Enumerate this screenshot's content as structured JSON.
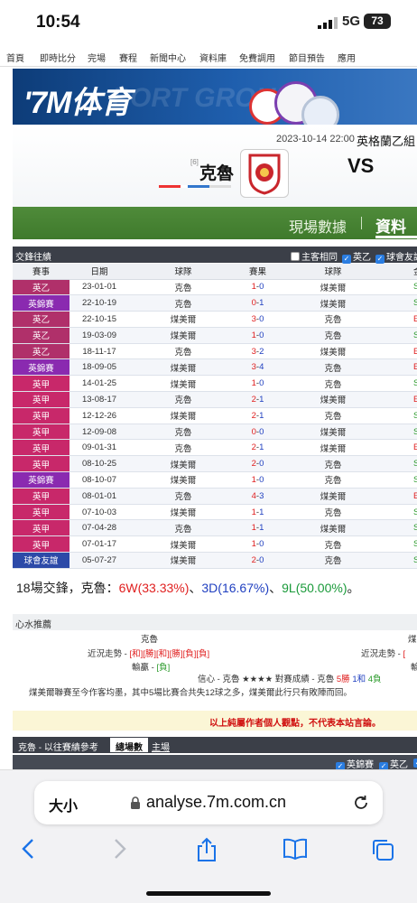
{
  "status": {
    "time": "10:54",
    "network": "5G",
    "battery": "73"
  },
  "topnav": [
    "首頁",
    "即時比分",
    "完場",
    "賽程",
    "新聞中心",
    "資料庫",
    "免費調用",
    "節目預告",
    "應用"
  ],
  "banner": {
    "logo": "'7M体育",
    "ghost_text": "PORT GROUP"
  },
  "match": {
    "datetime": "2023-10-14 22:00",
    "league": "英格蘭乙組",
    "rank": "[6]",
    "home": "克魯",
    "vs": "VS"
  },
  "tabs": {
    "live": "現場數據",
    "data": "資料分"
  },
  "h2h": {
    "title": "交鋒往績",
    "options": [
      {
        "label": "主客相同",
        "checked": false
      },
      {
        "label": "英乙",
        "checked": true
      },
      {
        "label": "球會友誼",
        "checked": true
      }
    ],
    "headers": [
      "賽事",
      "日期",
      "球隊",
      "賽果",
      "球隊",
      "金"
    ],
    "rows": [
      {
        "league": "英乙",
        "color": "#b0306a",
        "date": "23-01-01",
        "home": "克魯",
        "hr": true,
        "score_a": "1",
        "score_b": "0",
        "away": "煤美爾",
        "ar": false,
        "res": "S"
      },
      {
        "league": "英錦賽",
        "color": "#8a2ab0",
        "date": "22-10-19",
        "home": "克魯",
        "hr": false,
        "score_a": "0",
        "score_b": "1",
        "away": "煤美爾",
        "ar": true,
        "res": "S"
      },
      {
        "league": "英乙",
        "color": "#b0306a",
        "date": "22-10-15",
        "home": "煤美爾",
        "hr": true,
        "score_a": "3",
        "score_b": "0",
        "away": "克魯",
        "ar": false,
        "res": "E"
      },
      {
        "league": "英乙",
        "color": "#b0306a",
        "date": "19-03-09",
        "home": "煤美爾",
        "hr": true,
        "score_a": "1",
        "score_b": "0",
        "away": "克魯",
        "ar": false,
        "res": "S"
      },
      {
        "league": "英乙",
        "color": "#b0306a",
        "date": "18-11-17",
        "home": "克魯",
        "hr": true,
        "score_a": "3",
        "score_b": "2",
        "away": "煤美爾",
        "ar": false,
        "res": "E"
      },
      {
        "league": "英錦賽",
        "color": "#8a2ab0",
        "date": "18-09-05",
        "home": "煤美爾",
        "hr": false,
        "score_a": "3",
        "score_b": "4",
        "away": "克魯",
        "ar": true,
        "res": "E"
      },
      {
        "league": "英甲",
        "color": "#c8286a",
        "date": "14-01-25",
        "home": "煤美爾",
        "hr": true,
        "score_a": "1",
        "score_b": "0",
        "away": "克魯",
        "ar": false,
        "res": "S"
      },
      {
        "league": "英甲",
        "color": "#c8286a",
        "date": "13-08-17",
        "home": "克魯",
        "hr": true,
        "score_a": "2",
        "score_b": "1",
        "away": "煤美爾",
        "ar": false,
        "res": "E"
      },
      {
        "league": "英甲",
        "color": "#c8286a",
        "date": "12-12-26",
        "home": "煤美爾",
        "hr": true,
        "score_a": "2",
        "score_b": "1",
        "away": "克魯",
        "ar": false,
        "res": "S"
      },
      {
        "league": "英甲",
        "color": "#c8286a",
        "date": "12-09-08",
        "home": "克魯",
        "hr": false,
        "score_a": "0",
        "score_b": "0",
        "away": "煤美爾",
        "ar": false,
        "res": "S"
      },
      {
        "league": "英甲",
        "color": "#c8286a",
        "date": "09-01-31",
        "home": "克魯",
        "hr": true,
        "score_a": "2",
        "score_b": "1",
        "away": "煤美爾",
        "ar": false,
        "res": "E"
      },
      {
        "league": "英甲",
        "color": "#c8286a",
        "date": "08-10-25",
        "home": "煤美爾",
        "hr": true,
        "score_a": "2",
        "score_b": "0",
        "away": "克魯",
        "ar": false,
        "res": "S"
      },
      {
        "league": "英錦賽",
        "color": "#8a2ab0",
        "date": "08-10-07",
        "home": "煤美爾",
        "hr": true,
        "score_a": "1",
        "score_b": "0",
        "away": "克魯",
        "ar": false,
        "res": "S"
      },
      {
        "league": "英甲",
        "color": "#c8286a",
        "date": "08-01-01",
        "home": "克魯",
        "hr": true,
        "score_a": "4",
        "score_b": "3",
        "away": "煤美爾",
        "ar": false,
        "res": "E"
      },
      {
        "league": "英甲",
        "color": "#c8286a",
        "date": "07-10-03",
        "home": "煤美爾",
        "hr": false,
        "score_a": "1",
        "score_b": "1",
        "away": "克魯",
        "ar": false,
        "res": "S"
      },
      {
        "league": "英甲",
        "color": "#c8286a",
        "date": "07-04-28",
        "home": "克魯",
        "hr": false,
        "score_a": "1",
        "score_b": "1",
        "away": "煤美爾",
        "ar": false,
        "res": "S"
      },
      {
        "league": "英甲",
        "color": "#c8286a",
        "date": "07-01-17",
        "home": "煤美爾",
        "hr": true,
        "score_a": "1",
        "score_b": "0",
        "away": "克魯",
        "ar": false,
        "res": "S"
      },
      {
        "league": "球會友誼",
        "color": "#2c4aa8",
        "date": "05-07-27",
        "home": "煤美爾",
        "hr": true,
        "score_a": "2",
        "score_b": "0",
        "away": "克魯",
        "ar": false,
        "res": "S"
      }
    ]
  },
  "summary": {
    "prefix": "18場交鋒，克魯：",
    "w": "6W",
    "w_pct": "(33.33%)",
    "sep1": "、",
    "d": "3D",
    "d_pct": "(16.67%)",
    "sep2": "、",
    "l": "9L",
    "l_pct": "(50.00%)",
    "end": "。"
  },
  "tips": {
    "title": "心水推薦",
    "home_team": "克魯",
    "away_team": "煤",
    "home_form_label": "近況走勢 - ",
    "home_form": "[和][勝][和][勝][負][負]",
    "away_form_label": "近況走勢 - ",
    "away_form_short": "[",
    "handicap_label": "輸贏 - ",
    "handicap_value": "[負]",
    "away_handicap": "輸",
    "confidence": "信心 - 克魯 ★★★★ 對賽成績 - 克魯",
    "conf_w": "5勝",
    "conf_d": "1和",
    "conf_l": "4負",
    "comment": "煤美爾聯賽至今作客均墨，其中5場比賽合共失12球之多，煤美爾此行只有敗陣而回。",
    "disclaimer": "以上純屬作者個人觀點，不代表本站言論。"
  },
  "reference": {
    "title": "克魯 - 以往賽績參考",
    "tab_active": "總場數",
    "tab_home": "主場",
    "filters": [
      "英錦賽",
      "英乙"
    ]
  },
  "browser": {
    "text_size": "大小",
    "url": "analyse.7m.com.cn"
  }
}
